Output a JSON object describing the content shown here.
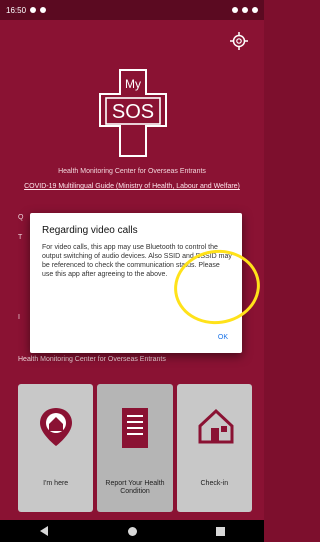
{
  "status_bar": {
    "time": "16:50"
  },
  "header": {
    "settings_icon": "gear-icon"
  },
  "logo": {
    "top_text": "My",
    "main_text": "SOS"
  },
  "health_center_label": "Health Monitoring Center for Overseas Entrants",
  "guide_link": "COVID-19 Multilingual Guide (Ministry of Health, Labour and Welfare)",
  "background": {
    "q_fragment": "Q",
    "t_fragment": "T",
    "i_fragment": "I",
    "footer_text": "Health Monitoring Center for Overseas Entrants"
  },
  "dialog": {
    "title": "Regarding video calls",
    "body": "For video calls, this app may use Bluetooth to control the output switching of audio devices. Also SSID and BSSID may be referenced to check the communication status. Please use this app after agreeing to the above.",
    "ok_label": "OK"
  },
  "tiles": [
    {
      "label": "I'm here",
      "icon": "location-home-icon"
    },
    {
      "label": "Report Your Health Condition",
      "icon": "document-icon"
    },
    {
      "label": "Check-in",
      "icon": "house-icon"
    }
  ],
  "colors": {
    "primary": "#8a1233",
    "tile_bg": "#c8c8c8",
    "accent": "#1a73e8",
    "highlight": "#ffe21a"
  }
}
